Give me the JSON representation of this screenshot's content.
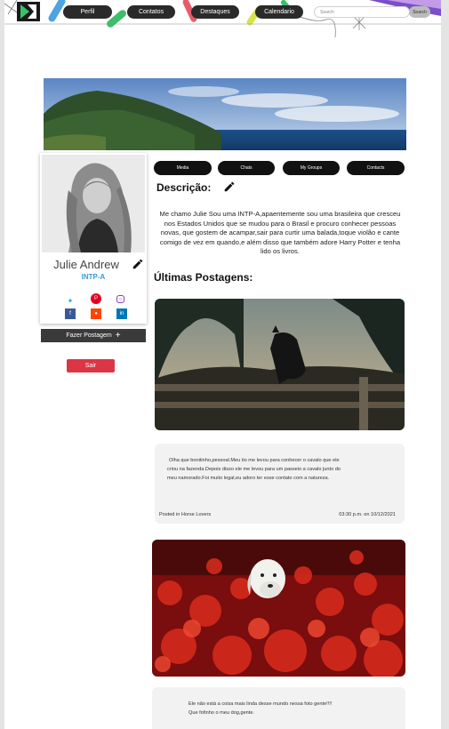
{
  "header": {
    "nav": [
      "Perfil",
      "Contatos",
      "Destaques",
      "Calendario"
    ],
    "search_placeholder": "Search",
    "search_button": "Search"
  },
  "profile": {
    "name": "Julie Andrew",
    "role": "INTP-A",
    "create_post": "Fazer Postagem",
    "logout": "Sair",
    "social_colors": {
      "twitter": "#1da1f2",
      "pinterest": "#e60023",
      "instagram": "#8a3ab9",
      "facebook": "#3b5998",
      "reddit": "#ff4500",
      "linkedin": "#0077b5"
    }
  },
  "tabs": [
    "Media",
    "Chats",
    "My Groups",
    "Contacts"
  ],
  "description": {
    "title": "Descrição:",
    "text": "Me chamo Julie Sou uma INTP-A,apaentemente sou uma brasileira que cresceu nos Estados Unidos que se mudou para o Brasil e procuro conhecer pessoas novas, que gostem de acampar,sair para curtir uma balada,toque violão e cante comigo de vez em quando,e além disso que também adore Harry Potter e tenha lido os livros."
  },
  "posts": {
    "title": "Últimas Postagens:",
    "items": [
      {
        "line1": "Olha que bonitinho,pessoal.Meu tio me levou para conhecer o cavalo que ele",
        "line2": "criou na fazenda.Depois disso ele me levou para um passeio a cavalo junto do",
        "line3": "meu namorado.Foi muito legal,eu adoro ter esse contato com a natureza.",
        "category": "Posted in Horse Lovers",
        "time": "03:30 p.m. on 10/12/2021"
      },
      {
        "line1": "Ele não está a coisa mais linda desse mundo nessa foto gente!!!!",
        "line2": "Que fofinho o meu dog,gente."
      }
    ]
  },
  "colors": {
    "accent": "#3a9ad9",
    "danger": "#dc3545",
    "dark": "#2a2a2a"
  }
}
